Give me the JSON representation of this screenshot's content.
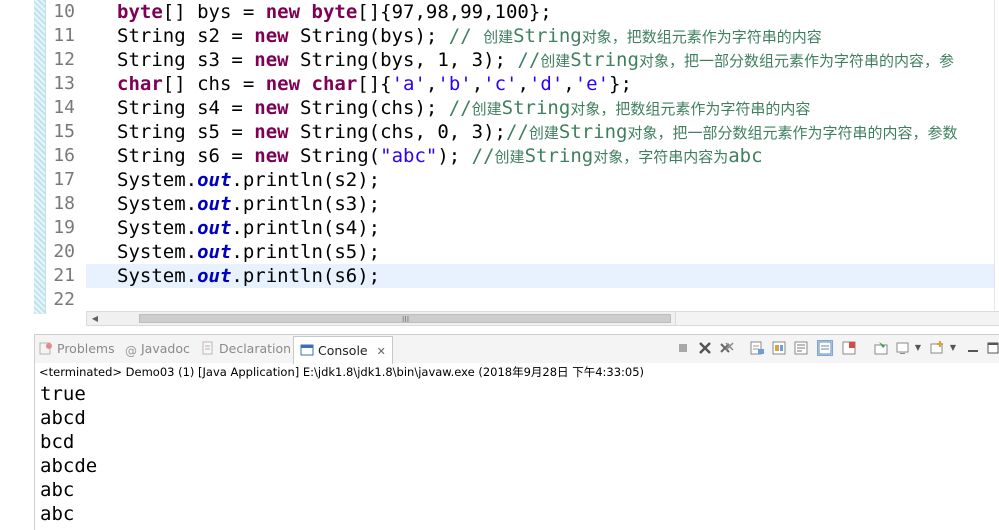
{
  "editor": {
    "line_numbers": [
      "10",
      "11",
      "12",
      "13",
      "14",
      "15",
      "16",
      "17",
      "18",
      "19",
      "20",
      "21",
      "22"
    ],
    "lines": [
      [
        {
          "t": "byte",
          "c": "kw"
        },
        {
          "t": "[] bys = "
        },
        {
          "t": "new",
          "c": "kw"
        },
        {
          "t": " "
        },
        {
          "t": "byte",
          "c": "kw"
        },
        {
          "t": "[]{97,98,99,100};"
        }
      ],
      [
        {
          "t": "String s2 = "
        },
        {
          "t": "new",
          "c": "kw"
        },
        {
          "t": " String(bys); "
        },
        {
          "t": "// ",
          "c": "cmt"
        },
        {
          "t": "创建",
          "c": "cmt cmt-cjk"
        },
        {
          "t": "String",
          "c": "cmt"
        },
        {
          "t": "对象，把数组元素作为字符串的内容",
          "c": "cmt cmt-cjk"
        }
      ],
      [
        {
          "t": "String s3 = "
        },
        {
          "t": "new",
          "c": "kw"
        },
        {
          "t": " String(bys, 1, 3); "
        },
        {
          "t": "//",
          "c": "cmt"
        },
        {
          "t": "创建",
          "c": "cmt cmt-cjk"
        },
        {
          "t": "String",
          "c": "cmt"
        },
        {
          "t": "对象，把一部分数组元素作为字符串的内容，参",
          "c": "cmt cmt-cjk"
        }
      ],
      [
        {
          "t": "char",
          "c": "kw"
        },
        {
          "t": "[] chs = "
        },
        {
          "t": "new",
          "c": "kw"
        },
        {
          "t": " "
        },
        {
          "t": "char",
          "c": "kw"
        },
        {
          "t": "[]{"
        },
        {
          "t": "'a'",
          "c": "str"
        },
        {
          "t": ","
        },
        {
          "t": "'b'",
          "c": "str"
        },
        {
          "t": ","
        },
        {
          "t": "'c'",
          "c": "str"
        },
        {
          "t": ","
        },
        {
          "t": "'d'",
          "c": "str"
        },
        {
          "t": ","
        },
        {
          "t": "'e'",
          "c": "str"
        },
        {
          "t": "};"
        }
      ],
      [
        {
          "t": "String s4 = "
        },
        {
          "t": "new",
          "c": "kw"
        },
        {
          "t": " String(chs); "
        },
        {
          "t": "//",
          "c": "cmt"
        },
        {
          "t": "创建",
          "c": "cmt cmt-cjk"
        },
        {
          "t": "String",
          "c": "cmt"
        },
        {
          "t": "对象，把数组元素作为字符串的内容",
          "c": "cmt cmt-cjk"
        }
      ],
      [
        {
          "t": "String s5 = "
        },
        {
          "t": "new",
          "c": "kw"
        },
        {
          "t": " String(chs, 0, 3);"
        },
        {
          "t": "//",
          "c": "cmt"
        },
        {
          "t": "创建",
          "c": "cmt cmt-cjk"
        },
        {
          "t": "String",
          "c": "cmt"
        },
        {
          "t": "对象，把一部分数组元素作为字符串的内容，参数",
          "c": "cmt cmt-cjk"
        }
      ],
      [
        {
          "t": "String s6 = "
        },
        {
          "t": "new",
          "c": "kw"
        },
        {
          "t": " String("
        },
        {
          "t": "\"abc\"",
          "c": "str"
        },
        {
          "t": "); "
        },
        {
          "t": "//",
          "c": "cmt"
        },
        {
          "t": "创建",
          "c": "cmt cmt-cjk"
        },
        {
          "t": "String",
          "c": "cmt"
        },
        {
          "t": "对象，字符串内容为",
          "c": "cmt cmt-cjk"
        },
        {
          "t": "abc",
          "c": "cmt"
        }
      ],
      [
        {
          "t": "System."
        },
        {
          "t": "out",
          "c": "fld"
        },
        {
          "t": ".println(s2);"
        }
      ],
      [
        {
          "t": "System."
        },
        {
          "t": "out",
          "c": "fld"
        },
        {
          "t": ".println(s3);"
        }
      ],
      [
        {
          "t": "System."
        },
        {
          "t": "out",
          "c": "fld"
        },
        {
          "t": ".println(s4);"
        }
      ],
      [
        {
          "t": "System."
        },
        {
          "t": "out",
          "c": "fld"
        },
        {
          "t": ".println(s5);"
        }
      ],
      [
        {
          "t": "System."
        },
        {
          "t": "out",
          "c": "fld"
        },
        {
          "t": ".println(s6);"
        }
      ],
      []
    ],
    "current_line_index": 11,
    "hscroll_grip": "III"
  },
  "panel": {
    "tabs": {
      "problems": "Problems",
      "javadoc": "Javadoc",
      "declaration": "Declaration",
      "console": "Console",
      "console_close": "✕"
    },
    "status": "<terminated> Demo03 (1) [Java Application] E:\\jdk1.8\\jdk1.8\\bin\\javaw.exe (2018年9月28日 下午4:33:05)",
    "output": [
      "true",
      "abcd",
      "bcd",
      "abcde",
      "abc",
      "abc"
    ]
  },
  "colors": {
    "keyword": "#7f0055",
    "string": "#2a00ff",
    "comment": "#3f7f5f",
    "field": "#0000c0",
    "current_line": "#e8f2fe"
  }
}
